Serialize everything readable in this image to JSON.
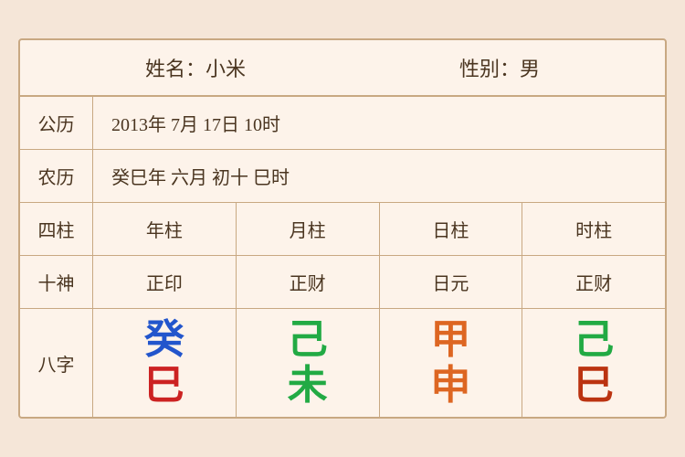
{
  "header": {
    "name_label": "姓名：小米",
    "gender_label": "性别：男"
  },
  "rows": [
    {
      "label": "公历",
      "content": "2013年 7月 17日 10时"
    },
    {
      "label": "农历",
      "content": "癸巳年 六月 初十 巳时"
    }
  ],
  "sizi": {
    "label": "四柱",
    "columns": [
      "年柱",
      "月柱",
      "日柱",
      "时柱"
    ]
  },
  "shishen": {
    "label": "十神",
    "columns": [
      "正印",
      "正财",
      "日元",
      "正财"
    ]
  },
  "bazhi": {
    "label": "八字",
    "columns": [
      {
        "top": "癸",
        "top_color": "color-blue",
        "bottom": "巳",
        "bottom_color": "color-red"
      },
      {
        "top": "己",
        "top_color": "color-green",
        "bottom": "未",
        "bottom_color": "color-green"
      },
      {
        "top": "甲",
        "top_color": "color-orange",
        "bottom": "申",
        "bottom_color": "color-orange"
      },
      {
        "top": "己",
        "top_color": "color-green2",
        "bottom": "巳",
        "bottom_color": "color-dark-red"
      }
    ]
  }
}
